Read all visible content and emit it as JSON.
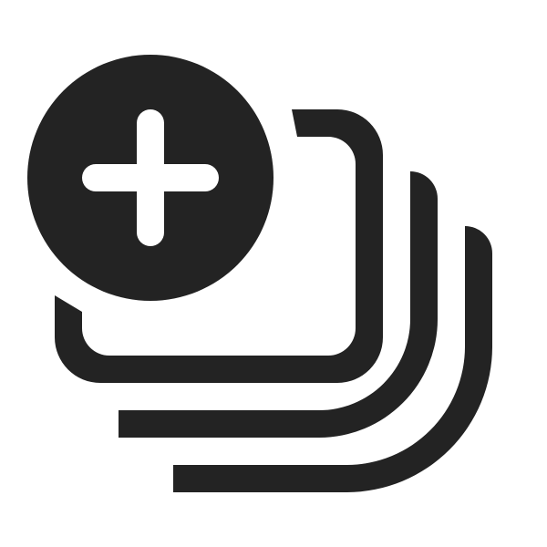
{
  "icon": {
    "name": "add-stack-icon",
    "components": [
      "stacked-cards",
      "plus-badge"
    ]
  },
  "colors": {
    "foreground": "#232323",
    "background": "#ffffff"
  }
}
